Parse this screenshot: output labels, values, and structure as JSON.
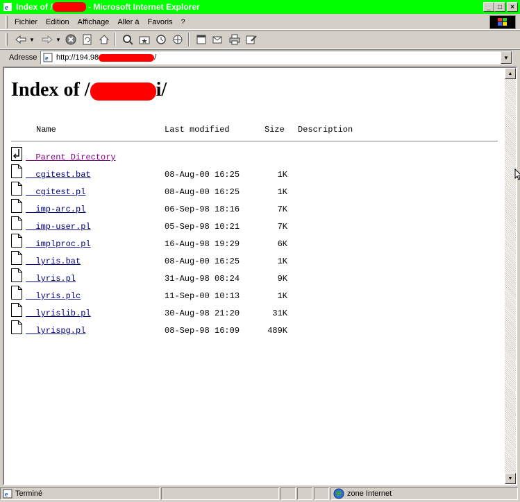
{
  "window": {
    "title_prefix": "Index of /",
    "title_suffix": " - Microsoft Internet Explorer",
    "minimize": "_",
    "maximize": "□",
    "close": "×"
  },
  "menu": [
    "Fichier",
    "Edition",
    "Affichage",
    "Aller à",
    "Favoris",
    "?"
  ],
  "address": {
    "label": "Adresse",
    "url_prefix": "http://194.98",
    "url_suffix": "/"
  },
  "page": {
    "heading_prefix": "Index of /",
    "heading_tail": "i/",
    "columns": {
      "name": "Name",
      "modified": "Last modified",
      "size": "Size",
      "description": "Description"
    },
    "parent": "Parent Directory",
    "files": [
      {
        "name": "cgitest.bat",
        "date": "08-Aug-00 16:25",
        "size": "1K"
      },
      {
        "name": "cgitest.pl",
        "date": "08-Aug-00 16:25",
        "size": "1K"
      },
      {
        "name": "imp-arc.pl",
        "date": "06-Sep-98 18:16",
        "size": "7K"
      },
      {
        "name": "imp-user.pl",
        "date": "05-Sep-98 10:21",
        "size": "7K"
      },
      {
        "name": "implproc.pl",
        "date": "16-Aug-98 19:29",
        "size": "6K"
      },
      {
        "name": "lyris.bat",
        "date": "08-Aug-00 16:25",
        "size": "1K"
      },
      {
        "name": "lyris.pl",
        "date": "31-Aug-98 08:24",
        "size": "9K"
      },
      {
        "name": "lyris.plc",
        "date": "11-Sep-00 10:13",
        "size": "1K"
      },
      {
        "name": "lyrislib.pl",
        "date": "30-Aug-98 21:20",
        "size": "31K"
      },
      {
        "name": "lyrispg.pl",
        "date": "08-Sep-98 16:09",
        "size": "489K"
      }
    ]
  },
  "status": {
    "text": "Terminé",
    "zone": "zone Internet"
  },
  "colors": {
    "titlebar": "#00ff00",
    "redaction": "#ff0000",
    "link": "#000080",
    "visited": "#800080"
  }
}
